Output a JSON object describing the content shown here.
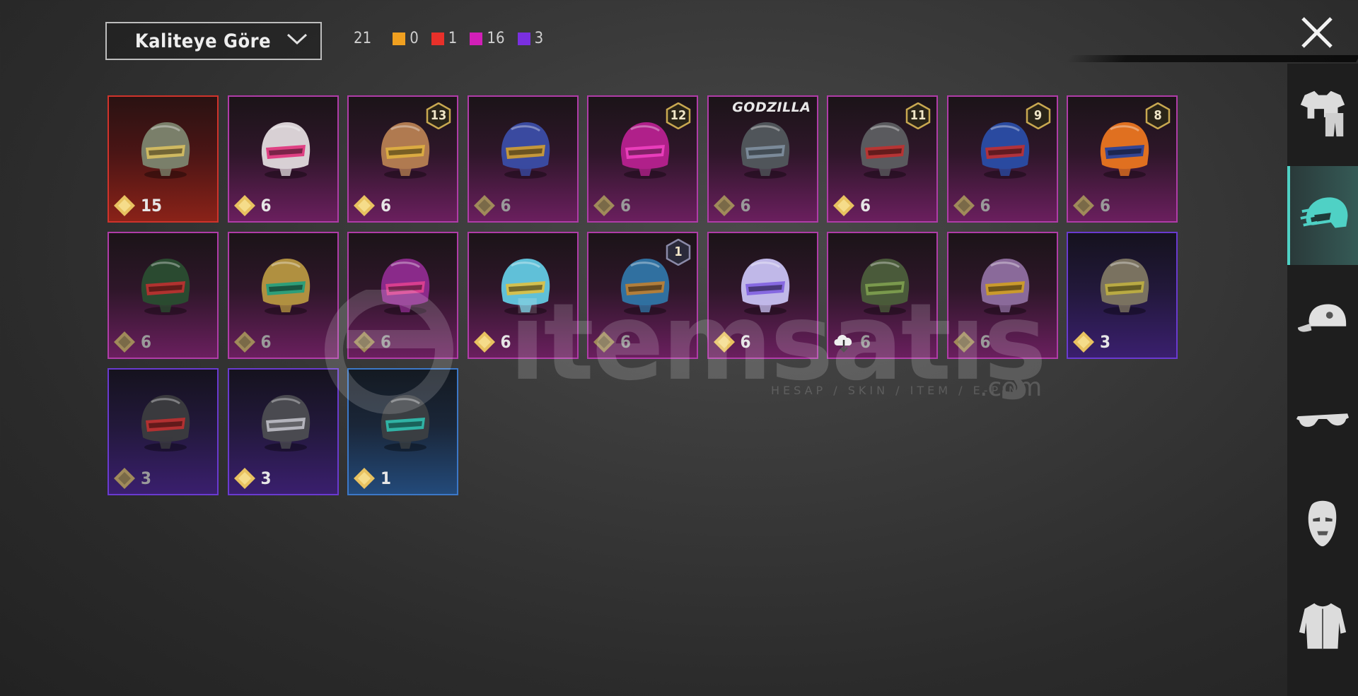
{
  "header": {
    "sort_label": "Kaliteye Göre",
    "total_count": "21",
    "quality_counts": [
      {
        "color": "#f0a020",
        "count": "0"
      },
      {
        "color": "#e8302a",
        "count": "1"
      },
      {
        "color": "#d21fb8",
        "count": "16"
      },
      {
        "color": "#7a2fe0",
        "count": "3"
      }
    ]
  },
  "watermark": {
    "text": "itemsatış",
    "subtitle": "HESAP / SKIN / ITEM / E-PIN",
    "suffix": ".com"
  },
  "items": [
    {
      "quality": "red",
      "count": "15",
      "level": "",
      "tag": "",
      "badge": "gold",
      "helmet": "#7a7f6a",
      "accent": "#d8c060"
    },
    {
      "quality": "pink",
      "count": "6",
      "level": "",
      "tag": "",
      "badge": "gold",
      "helmet": "#d8d0d4",
      "accent": "#e0307a"
    },
    {
      "quality": "pink",
      "count": "6",
      "level": "13",
      "tag": "",
      "badge": "gold",
      "helmet": "#b07a50",
      "accent": "#e0b040"
    },
    {
      "quality": "pink",
      "count": "6",
      "level": "",
      "tag": "",
      "badge": "dim",
      "helmet": "#3a4aa0",
      "accent": "#d4a030"
    },
    {
      "quality": "pink",
      "count": "6",
      "level": "12",
      "tag": "",
      "badge": "dim",
      "helmet": "#b0208a",
      "accent": "#f040c0"
    },
    {
      "quality": "pink",
      "count": "6",
      "level": "",
      "tag": "GODZILLA",
      "badge": "dim",
      "helmet": "#50555a",
      "accent": "#8090a0"
    },
    {
      "quality": "pink",
      "count": "6",
      "level": "11",
      "tag": "",
      "badge": "gold",
      "helmet": "#5a5a5e",
      "accent": "#c03030"
    },
    {
      "quality": "pink",
      "count": "6",
      "level": "9",
      "tag": "",
      "badge": "dim",
      "helmet": "#2a4aa0",
      "accent": "#c03030"
    },
    {
      "quality": "pink",
      "count": "6",
      "level": "8",
      "tag": "",
      "badge": "dim",
      "helmet": "#e07020",
      "accent": "#2040a0"
    },
    {
      "quality": "pink",
      "count": "6",
      "level": "",
      "tag": "",
      "badge": "dim",
      "helmet": "#2a4a30",
      "accent": "#c03030"
    },
    {
      "quality": "pink",
      "count": "6",
      "level": "",
      "tag": "",
      "badge": "dim",
      "helmet": "#b09040",
      "accent": "#20a080"
    },
    {
      "quality": "pink",
      "count": "6",
      "level": "",
      "tag": "",
      "badge": "dim",
      "helmet": "#8a2a8a",
      "accent": "#e04090"
    },
    {
      "quality": "pink",
      "count": "6",
      "level": "",
      "tag": "",
      "badge": "gold",
      "helmet": "#60c0d8",
      "accent": "#e0c040"
    },
    {
      "quality": "pink",
      "count": "6",
      "level": "1",
      "tag": "",
      "badge": "dim",
      "helmet": "#3070a0",
      "accent": "#c08030"
    },
    {
      "quality": "pink",
      "count": "6",
      "level": "",
      "tag": "",
      "badge": "gold",
      "helmet": "#c0b8e8",
      "accent": "#8060e0"
    },
    {
      "quality": "pink",
      "count": "6",
      "level": "",
      "tag": "",
      "badge": "download",
      "helmet": "#4a5a3a",
      "accent": "#80a050"
    },
    {
      "quality": "pink",
      "count": "6",
      "level": "",
      "tag": "",
      "badge": "dim",
      "helmet": "#8a6a9a",
      "accent": "#d0a020"
    },
    {
      "quality": "purple",
      "count": "3",
      "level": "",
      "tag": "",
      "badge": "gold",
      "helmet": "#7a7260",
      "accent": "#c0b040"
    },
    {
      "quality": "purple",
      "count": "3",
      "level": "",
      "tag": "",
      "badge": "dim",
      "helmet": "#3a3a3e",
      "accent": "#c03030"
    },
    {
      "quality": "purple",
      "count": "3",
      "level": "",
      "tag": "",
      "badge": "gold",
      "helmet": "#4a4a50",
      "accent": "#c0c0c8"
    },
    {
      "quality": "blue",
      "count": "1",
      "level": "",
      "tag": "",
      "badge": "gold",
      "helmet": "#3a3e42",
      "accent": "#30c0b0"
    }
  ],
  "sidebar": {
    "tabs": [
      {
        "name": "outfit",
        "icon": "outfit-icon",
        "active": false
      },
      {
        "name": "helmet",
        "icon": "helmet-icon",
        "active": true
      },
      {
        "name": "hat",
        "icon": "cap-icon",
        "active": false
      },
      {
        "name": "glasses",
        "icon": "glasses-icon",
        "active": false
      },
      {
        "name": "mask",
        "icon": "mask-icon",
        "active": false
      },
      {
        "name": "jacket",
        "icon": "jacket-icon",
        "active": false
      }
    ],
    "active_color": "#4fd1c5"
  }
}
